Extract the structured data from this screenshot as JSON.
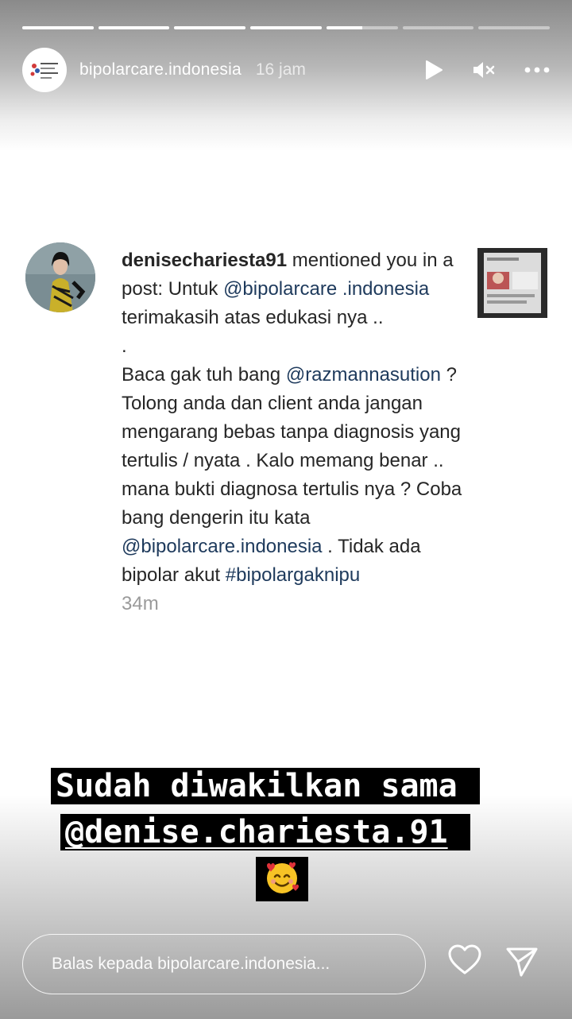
{
  "story": {
    "segments": [
      1,
      1,
      1,
      1,
      0.5,
      0,
      0
    ],
    "username": "bipolarcare.indonesia",
    "time_ago": "16 jam"
  },
  "header_icons": [
    "play-icon",
    "mute-icon",
    "more-icon"
  ],
  "notification": {
    "username": "denisechariesta91",
    "text_1": " mentioned you in a post: Untuk ",
    "mention_1": "@bipolarcare .indonesia",
    "text_2": " terimakasih atas edukasi nya ..",
    "dot": ".",
    "text_3": "Baca gak tuh bang ",
    "mention_2": "@razmannasution",
    "text_4": " ? Tolong anda dan client anda jangan mengarang bebas tanpa diagnosis yang tertulis / nyata . Kalo memang benar .. mana bukti diagnosa tertulis nya ? Coba bang dengerin itu kata ",
    "mention_3": "@bipolarcare.indonesia",
    "text_5": " . Tidak ada bipolar akut ",
    "hashtag": "#bipolargaknipu",
    "timestamp": "34m"
  },
  "stickers": {
    "line_1": "Sudah diwakilkan sama",
    "line_2": "@denise.chariesta.91",
    "emoji": "🥰"
  },
  "reply": {
    "placeholder": "Balas kepada bipolarcare.indonesia..."
  },
  "colors": {
    "mention": "#1e3a5c",
    "text": "#262626",
    "sticker_bg": "#000000"
  }
}
